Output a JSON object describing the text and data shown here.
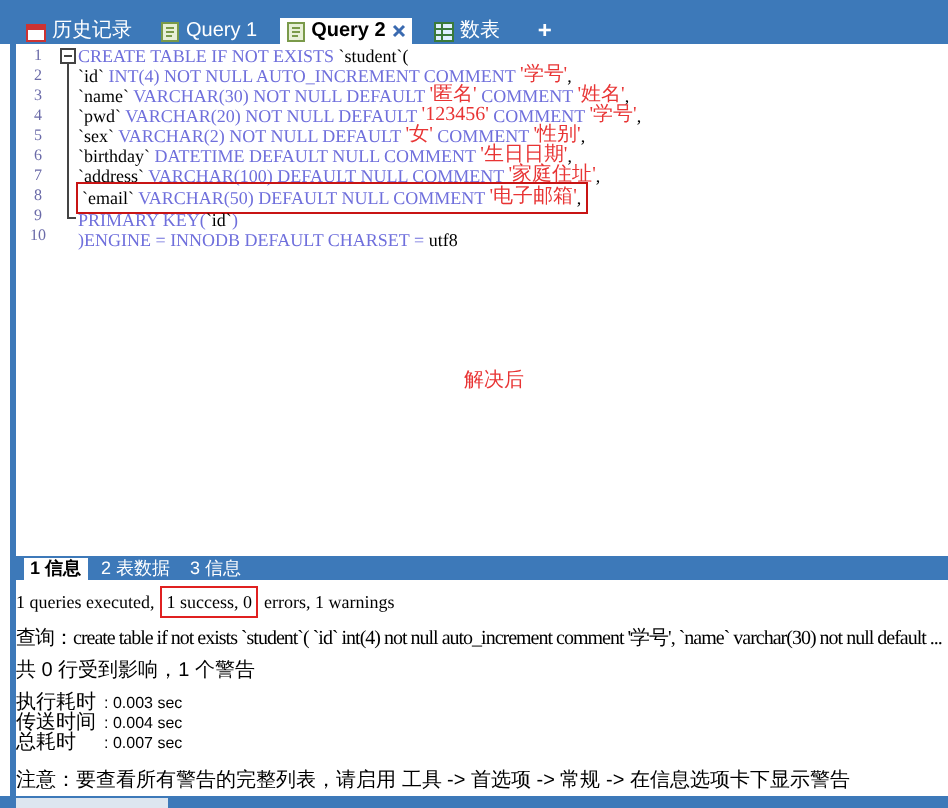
{
  "tabs": [
    {
      "label": "历史记录",
      "kind": "history",
      "selected": false
    },
    {
      "label": "Query 1",
      "kind": "query",
      "selected": false
    },
    {
      "label": "Query 2",
      "kind": "query",
      "selected": true,
      "closable": true
    },
    {
      "label": "数表",
      "kind": "table",
      "selected": false
    }
  ],
  "add_tab": "+",
  "editor": {
    "lines": [
      {
        "number": "1",
        "annotated": false,
        "segments": [
          {
            "kind": "kw",
            "text": "CREATE TABLE IF NOT EXISTS "
          },
          {
            "kind": "id",
            "text": "`student`("
          }
        ]
      },
      {
        "number": "2",
        "annotated": false,
        "segments": [
          {
            "kind": "id",
            "text": "`id`"
          },
          {
            "kind": "kw",
            "text": " INT(4) NOT NULL AUTO_INCREMENT COMMENT "
          },
          {
            "kind": "str",
            "text": "'学号'"
          },
          {
            "kind": "id",
            "text": ","
          }
        ]
      },
      {
        "number": "3",
        "annotated": false,
        "segments": [
          {
            "kind": "id",
            "text": "`name`"
          },
          {
            "kind": "kw",
            "text": " VARCHAR(30) NOT NULL DEFAULT "
          },
          {
            "kind": "str",
            "text": "'匿名'"
          },
          {
            "kind": "kw",
            "text": " COMMENT "
          },
          {
            "kind": "str",
            "text": "'姓名'"
          },
          {
            "kind": "id",
            "text": ","
          }
        ]
      },
      {
        "number": "4",
        "annotated": false,
        "segments": [
          {
            "kind": "id",
            "text": "`pwd`"
          },
          {
            "kind": "kw",
            "text": " VARCHAR(20) NOT NULL DEFAULT "
          },
          {
            "kind": "str",
            "text": "'123456'"
          },
          {
            "kind": "kw",
            "text": " COMMENT "
          },
          {
            "kind": "str",
            "text": "'学号'"
          },
          {
            "kind": "id",
            "text": ","
          }
        ]
      },
      {
        "number": "5",
        "annotated": false,
        "segments": [
          {
            "kind": "id",
            "text": "`sex`"
          },
          {
            "kind": "kw",
            "text": " VARCHAR(2) NOT NULL DEFAULT "
          },
          {
            "kind": "str",
            "text": "'女'"
          },
          {
            "kind": "kw",
            "text": " COMMENT "
          },
          {
            "kind": "str",
            "text": "'性别'"
          },
          {
            "kind": "id",
            "text": ","
          }
        ]
      },
      {
        "number": "6",
        "annotated": false,
        "segments": [
          {
            "kind": "id",
            "text": "`birthday`"
          },
          {
            "kind": "kw",
            "text": " DATETIME DEFAULT NULL COMMENT "
          },
          {
            "kind": "str",
            "text": "'生日日期'"
          },
          {
            "kind": "id",
            "text": ","
          }
        ]
      },
      {
        "number": "7",
        "annotated": false,
        "segments": [
          {
            "kind": "id",
            "text": "`address`"
          },
          {
            "kind": "kw",
            "text": " VARCHAR(100) DEFAULT NULL COMMENT "
          },
          {
            "kind": "str",
            "text": "'家庭住址'"
          },
          {
            "kind": "id",
            "text": ","
          }
        ]
      },
      {
        "number": "8",
        "annotated": true,
        "segments": [
          {
            "kind": "id",
            "text": "`email`"
          },
          {
            "kind": "kw",
            "text": " VARCHAR(50) DEFAULT NULL COMMENT "
          },
          {
            "kind": "str",
            "text": "'电子邮箱'"
          },
          {
            "kind": "id",
            "text": ","
          }
        ]
      },
      {
        "number": "9",
        "annotated": false,
        "segments": [
          {
            "kind": "kw",
            "text": "PRIMARY KEY("
          },
          {
            "kind": "id",
            "text": "`id`"
          },
          {
            "kind": "kw",
            "text": ")"
          }
        ]
      },
      {
        "number": "10",
        "annotated": false,
        "segments": [
          {
            "kind": "kw",
            "text": ")ENGINE = INNODB DEFAULT CHARSET = "
          },
          {
            "kind": "id",
            "text": "utf8"
          }
        ]
      }
    ],
    "note": "解决后"
  },
  "result_tabs": [
    {
      "label": "1 信息",
      "selected": true
    },
    {
      "label": "2 表数据",
      "selected": false
    },
    {
      "label": "3 信息",
      "selected": false
    }
  ],
  "messages": {
    "summary": [
      {
        "text": "1 queries executed,",
        "annotated": false
      },
      {
        "text": "1 success, 0",
        "annotated": true
      },
      {
        "text": "errors, 1 warnings",
        "annotated": false
      }
    ],
    "query": "查询：create table if not exists `student`( `id` int(4) not null auto_increment comment '学号', `name` varchar(30) not null default ...",
    "affected": "共 0 行受到影响，1 个警告",
    "timings": [
      {
        "label": "执行耗时",
        "value": ": 0.003 sec"
      },
      {
        "label": "传送时间",
        "value": ": 0.004 sec"
      },
      {
        "label": "总耗时",
        "value": ": 0.007 sec"
      }
    ],
    "notice": "注意：要查看所有警告的完整列表，请启用 工具 -> 首选项 -> 常规 -> 在信息选项卡下显示警告"
  }
}
